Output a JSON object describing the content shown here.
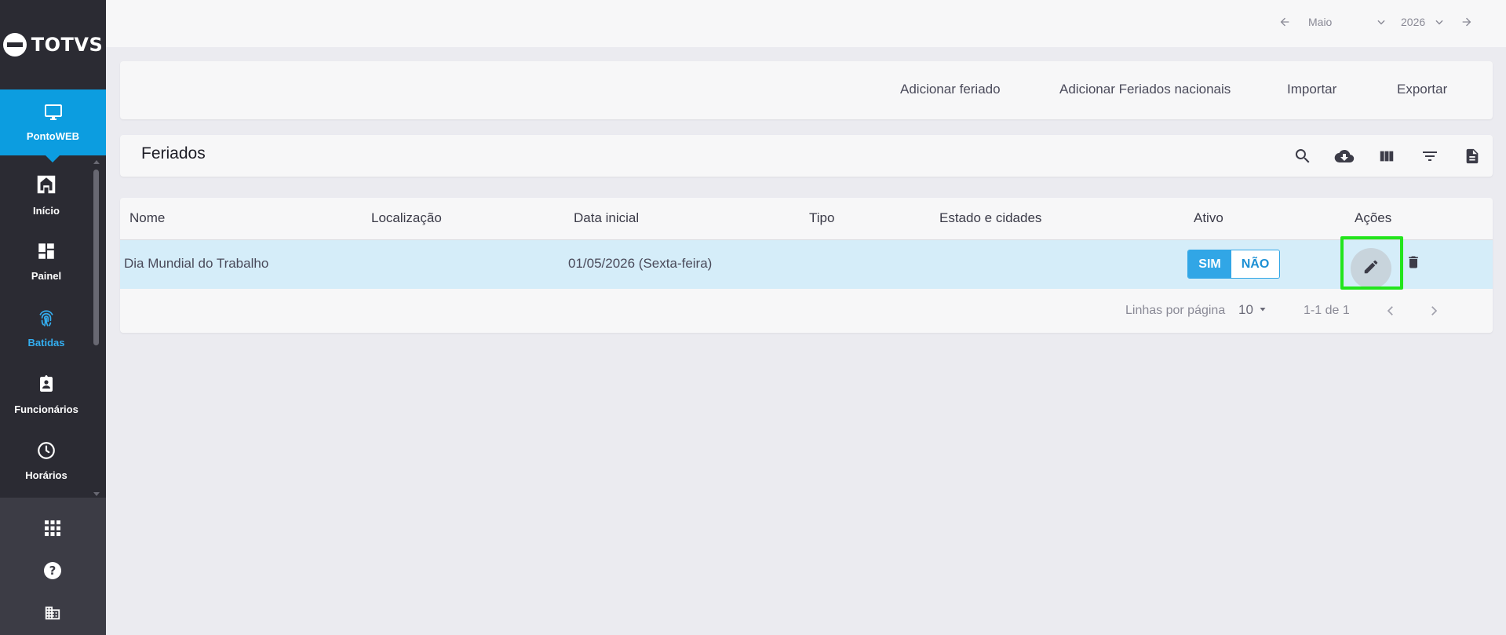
{
  "brand": {
    "logo_text": "TOTVS"
  },
  "sidebar": {
    "active_item": {
      "label": "PontoWEB",
      "icon": "monitor-icon"
    },
    "items": [
      {
        "label": "Início",
        "icon": "home-icon"
      },
      {
        "label": "Painel",
        "icon": "dashboard-icon"
      },
      {
        "label": "Batidas",
        "icon": "fingerprint-icon"
      },
      {
        "label": "Funcionários",
        "icon": "badge-icon"
      },
      {
        "label": "Horários",
        "icon": "clock-icon"
      }
    ],
    "bottom_icons": [
      "apps-grid-icon",
      "help-icon",
      "building-icon"
    ]
  },
  "period": {
    "month": "Maio",
    "year": "2026"
  },
  "actions": {
    "add_holiday": "Adicionar feriado",
    "add_national": "Adicionar Feriados nacionais",
    "import": "Importar",
    "export": "Exportar"
  },
  "page": {
    "title": "Feriados"
  },
  "toolbar_icons": [
    "search-icon",
    "cloud-download-icon",
    "columns-icon",
    "filter-icon",
    "document-icon"
  ],
  "table": {
    "headers": [
      "Nome",
      "Localização",
      "Data inicial",
      "Tipo",
      "Estado e cidades",
      "Ativo",
      "Ações"
    ],
    "rows": [
      {
        "nome": "Dia Mundial do Trabalho",
        "localizacao": "",
        "data_inicial": "01/05/2026 (Sexta-feira)",
        "tipo": "",
        "estado": "",
        "ativo_on": "SIM",
        "ativo_off": "NÃO"
      }
    ]
  },
  "pagination": {
    "rows_label": "Linhas por página",
    "rows_value": "10",
    "range": "1-1 de 1"
  },
  "colors": {
    "accent": "#0c9de0",
    "sidebar_bg": "#2b2b33",
    "row_highlight": "#d5edf9",
    "focus_box": "#22e51c"
  }
}
